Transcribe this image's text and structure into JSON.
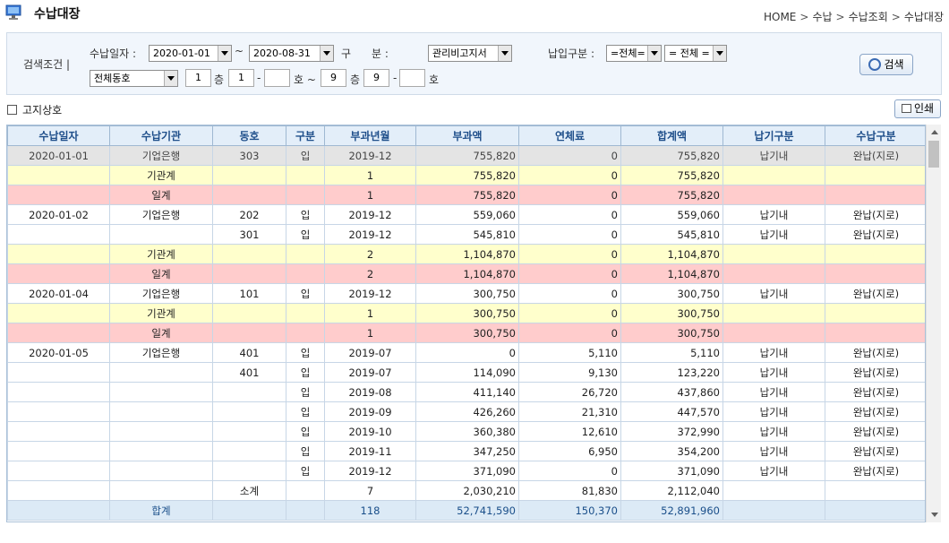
{
  "header": {
    "title": "수납대장",
    "breadcrumb": [
      "HOME",
      "수납",
      "수납조회",
      "수납대장"
    ]
  },
  "search": {
    "label": "검색조건 |",
    "date_label": "수납일자 :",
    "date_from": "2020-01-01",
    "date_to": "2020-08-31",
    "tilde": "~",
    "category_label_a": "구",
    "category_label_b": "분 :",
    "category_value": "관리비고지서",
    "pay_type_label": "납입구분 :",
    "pay_type_1": "=전체=",
    "pay_type_2": "= 전체 =",
    "building_value": "전체동호",
    "floor_from": "1",
    "floor_unit": "층",
    "unit_from": "1",
    "dash": "-",
    "unit_from_2": "",
    "ho_label": "호 ~",
    "floor_to": "9",
    "unit_to": "9",
    "unit_to_2": "",
    "ho_end": "호",
    "search_button": "검색"
  },
  "notice": {
    "label": "고지상호"
  },
  "print_button": "인쇄",
  "table": {
    "headers": [
      "수납일자",
      "수납기관",
      "동호",
      "구분",
      "부과년월",
      "부과액",
      "연체료",
      "합계액",
      "납기구분",
      "수납구분"
    ],
    "rows": [
      {
        "type": "selected",
        "cells": [
          "2020-01-01",
          "기업은행",
          "303",
          "입",
          "2019-12",
          "755,820",
          "0",
          "755,820",
          "납기내",
          "완납(지로)"
        ]
      },
      {
        "type": "inst",
        "cells": [
          "",
          "기관계",
          "",
          "",
          "1",
          "755,820",
          "0",
          "755,820",
          "",
          ""
        ]
      },
      {
        "type": "day",
        "cells": [
          "",
          "일계",
          "",
          "",
          "1",
          "755,820",
          "0",
          "755,820",
          "",
          ""
        ]
      },
      {
        "type": "data",
        "cells": [
          "2020-01-02",
          "기업은행",
          "202",
          "입",
          "2019-12",
          "559,060",
          "0",
          "559,060",
          "납기내",
          "완납(지로)"
        ]
      },
      {
        "type": "data",
        "cells": [
          "",
          "",
          "301",
          "입",
          "2019-12",
          "545,810",
          "0",
          "545,810",
          "납기내",
          "완납(지로)"
        ]
      },
      {
        "type": "inst",
        "cells": [
          "",
          "기관계",
          "",
          "",
          "2",
          "1,104,870",
          "0",
          "1,104,870",
          "",
          ""
        ]
      },
      {
        "type": "day",
        "cells": [
          "",
          "일계",
          "",
          "",
          "2",
          "1,104,870",
          "0",
          "1,104,870",
          "",
          ""
        ]
      },
      {
        "type": "data",
        "cells": [
          "2020-01-04",
          "기업은행",
          "101",
          "입",
          "2019-12",
          "300,750",
          "0",
          "300,750",
          "납기내",
          "완납(지로)"
        ]
      },
      {
        "type": "inst",
        "cells": [
          "",
          "기관계",
          "",
          "",
          "1",
          "300,750",
          "0",
          "300,750",
          "",
          ""
        ]
      },
      {
        "type": "day",
        "cells": [
          "",
          "일계",
          "",
          "",
          "1",
          "300,750",
          "0",
          "300,750",
          "",
          ""
        ]
      },
      {
        "type": "data",
        "cells": [
          "2020-01-05",
          "기업은행",
          "401",
          "입",
          "2019-07",
          "0",
          "5,110",
          "5,110",
          "납기내",
          "완납(지로)"
        ]
      },
      {
        "type": "data",
        "cells": [
          "",
          "",
          "401",
          "입",
          "2019-07",
          "114,090",
          "9,130",
          "123,220",
          "납기내",
          "완납(지로)"
        ]
      },
      {
        "type": "data",
        "cells": [
          "",
          "",
          "",
          "입",
          "2019-08",
          "411,140",
          "26,720",
          "437,860",
          "납기내",
          "완납(지로)"
        ]
      },
      {
        "type": "data",
        "cells": [
          "",
          "",
          "",
          "입",
          "2019-09",
          "426,260",
          "21,310",
          "447,570",
          "납기내",
          "완납(지로)"
        ]
      },
      {
        "type": "data",
        "cells": [
          "",
          "",
          "",
          "입",
          "2019-10",
          "360,380",
          "12,610",
          "372,990",
          "납기내",
          "완납(지로)"
        ]
      },
      {
        "type": "data",
        "cells": [
          "",
          "",
          "",
          "입",
          "2019-11",
          "347,250",
          "6,950",
          "354,200",
          "납기내",
          "완납(지로)"
        ]
      },
      {
        "type": "data",
        "cells": [
          "",
          "",
          "",
          "입",
          "2019-12",
          "371,090",
          "0",
          "371,090",
          "납기내",
          "완납(지로)"
        ]
      },
      {
        "type": "data",
        "cells": [
          "",
          "",
          "소계",
          "",
          "7",
          "2,030,210",
          "81,830",
          "2,112,040",
          "",
          ""
        ]
      },
      {
        "type": "total",
        "cells": [
          "",
          "합계",
          "",
          "",
          "118",
          "52,741,590",
          "150,370",
          "52,891,960",
          "",
          ""
        ]
      }
    ]
  }
}
